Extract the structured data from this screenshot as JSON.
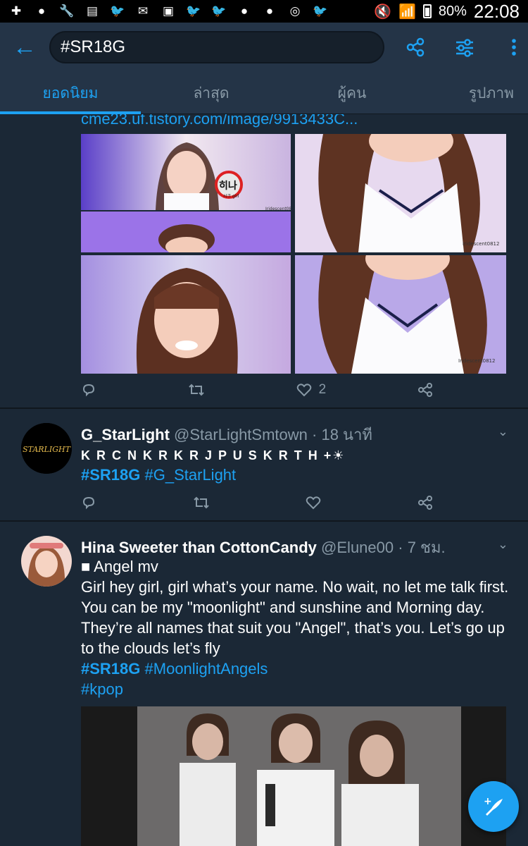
{
  "status_bar": {
    "battery": "80%",
    "time": "22:08",
    "icons": [
      "plus-icon",
      "line-icon",
      "wrench-icon",
      "sim-icon",
      "twitter-icon",
      "mail-icon",
      "gallery-icon",
      "twitter-icon",
      "twitter-icon",
      "line-icon",
      "line-icon",
      "chrome-icon",
      "twitter-icon"
    ]
  },
  "search": {
    "query": "#SR18G"
  },
  "tabs": [
    "ยอดนิยม",
    "ล่าสุด",
    "ผู้คน",
    "รูปภาพ"
  ],
  "colors": {
    "accent": "#1da1f2",
    "background": "#1b2836",
    "bar": "#243447",
    "muted": "#8899a6"
  },
  "tweet1": {
    "link": "cme23.uf.tistory.com/image/9913433C...",
    "likes": "2",
    "photo_text": {
      "badge": "히나",
      "badge_sub": "시크 girl",
      "watermark": "Iridescent0812"
    }
  },
  "tweet2": {
    "name": "G_StarLight",
    "handle": "@StarLightSmtown",
    "time": "· 18 นาที",
    "avatar_text": "STARLIGHT",
    "line1": "🇰🇷🇨🇳🇰🇷🇰🇷🇯🇵🇺🇸🇰🇷🇹🇭+☀",
    "line1_display": "K R C N K R K R J P U S K R T H +☀",
    "tags": {
      "t1": "#SR18G",
      "t2": "#G_StarLight"
    }
  },
  "tweet3": {
    "name": "Hina Sweeter than CottonCandy",
    "handle": "@Elune00",
    "time": "· 7 ชม.",
    "line1": "■ Angel mv",
    "text": "Girl hey girl, girl what’s your name. No wait, no let me talk first. You can be my \"moonlight\" and sunshine and Morning day. They’re all names that suit you \"Angel\", that’s you. Let’s go up to the clouds let’s fly",
    "tags": {
      "t1": "#SR18G",
      "t2": "#MoonlightAngels",
      "t3": "#kpop"
    }
  }
}
